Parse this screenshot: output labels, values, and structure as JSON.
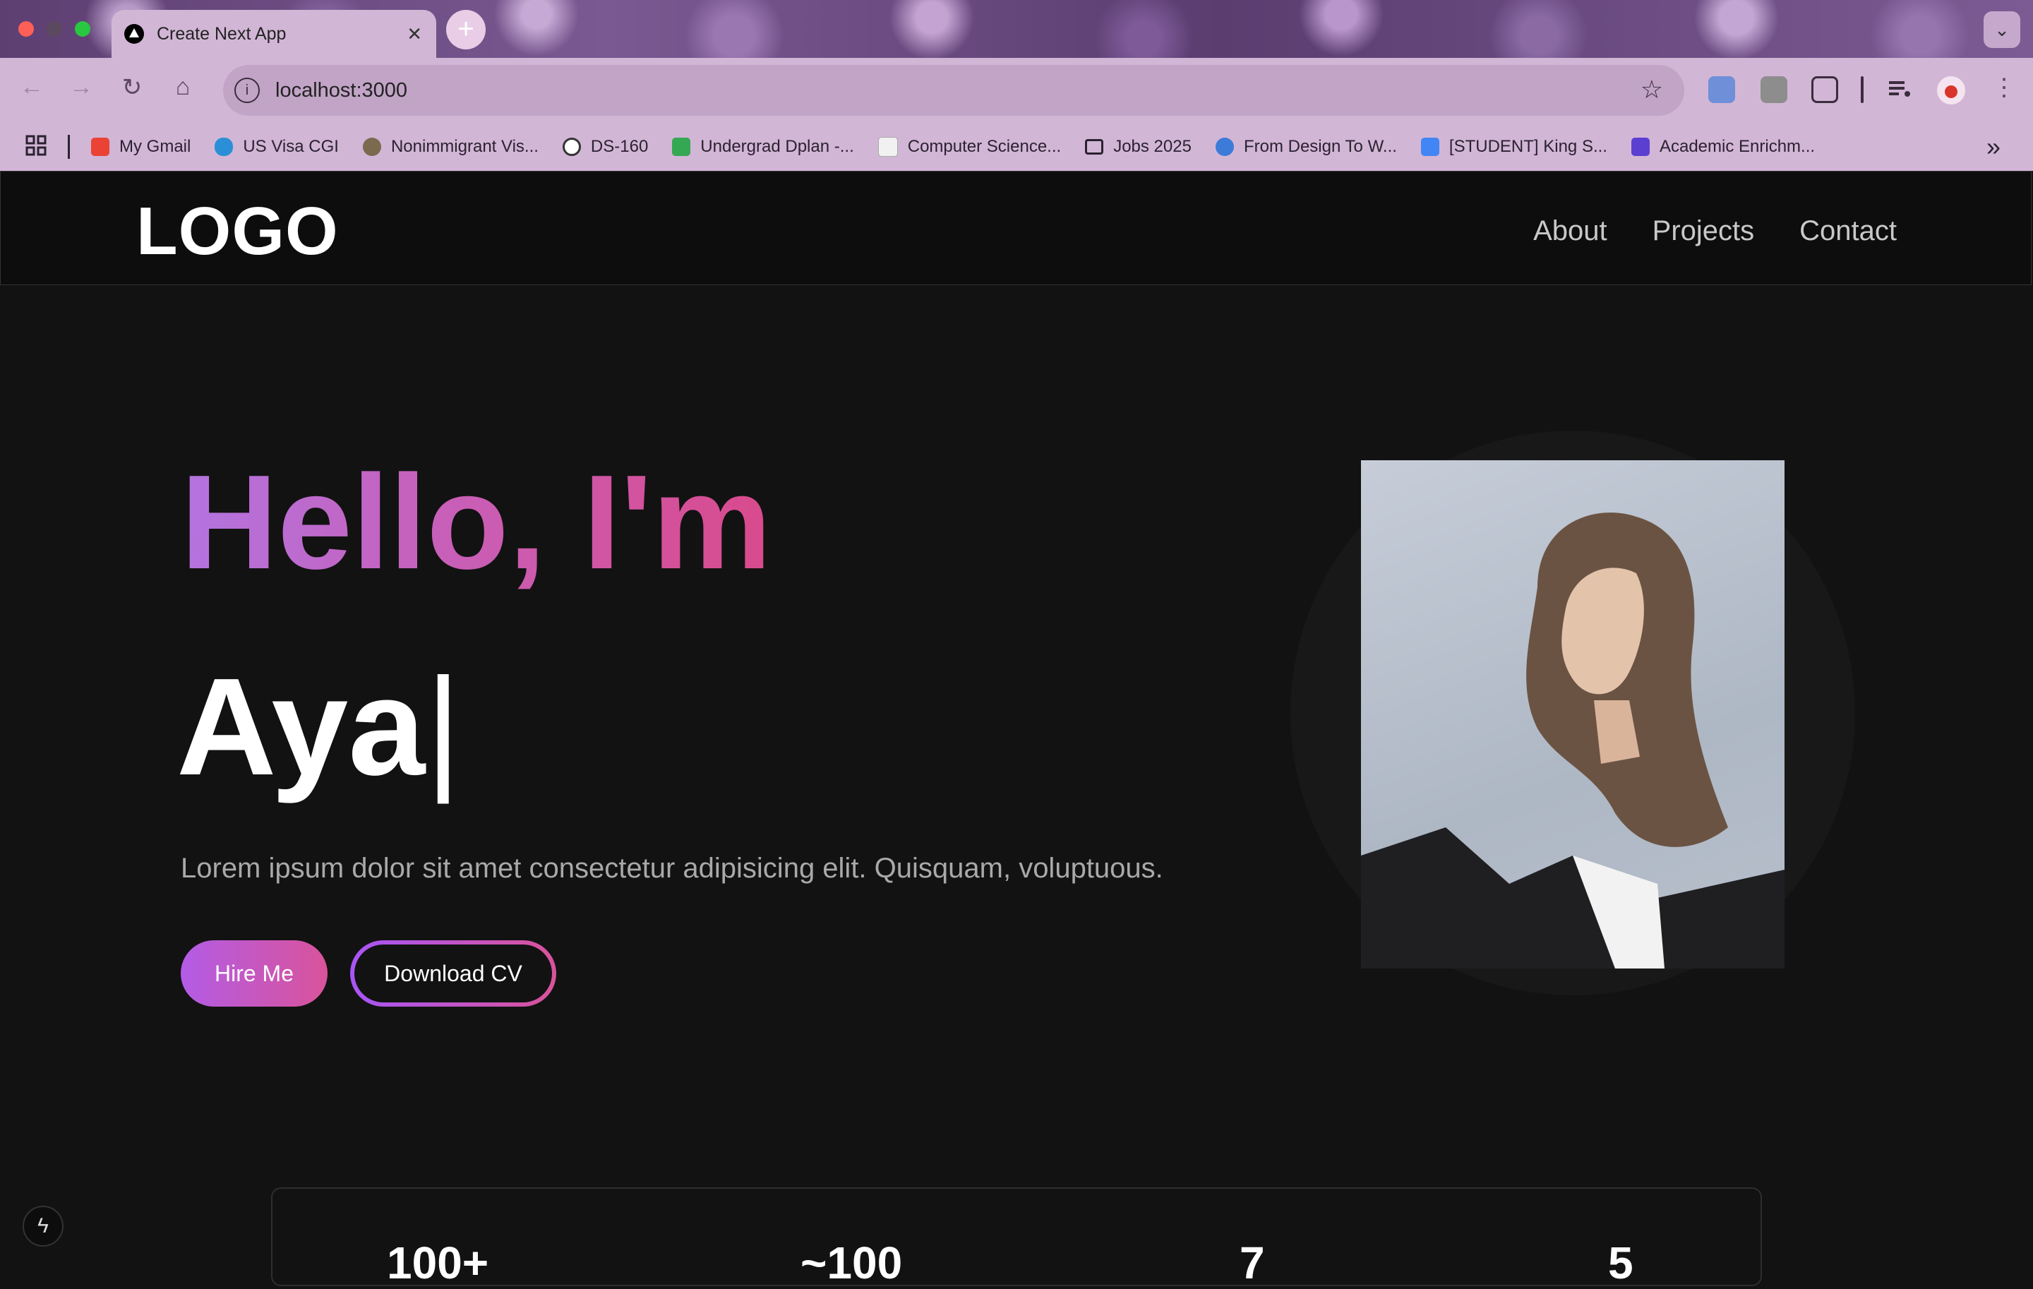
{
  "browser": {
    "tab_title": "Create Next App",
    "new_tab": "+",
    "close": "✕",
    "url": "localhost:3000",
    "bookmarks": [
      {
        "label": "My Gmail",
        "color": "#ea4335"
      },
      {
        "label": "US Visa CGI",
        "color": "#2a8fd6"
      },
      {
        "label": "Nonimmigrant Vis...",
        "color": "#7b6a4e"
      },
      {
        "label": "DS-160",
        "color": "#ffffff"
      },
      {
        "label": "Undergrad Dplan -...",
        "color": "#34a853"
      },
      {
        "label": "Computer Science...",
        "color": "#f1f1f1"
      },
      {
        "label": "Jobs 2025",
        "color": "#d2b6d6"
      },
      {
        "label": "From Design To W...",
        "color": "#3c7bd8"
      },
      {
        "label": "[STUDENT] King S...",
        "color": "#4285f4"
      },
      {
        "label": "Academic Enrichm...",
        "color": "#5b3fd1"
      }
    ],
    "more_bookmarks": "»"
  },
  "site": {
    "logo": "LOGO",
    "nav": [
      "About",
      "Projects",
      "Contact"
    ],
    "hero": {
      "greeting": "Hello, I'm",
      "name": "Aya",
      "cursor": "|",
      "description": "Lorem ipsum dolor sit amet consectetur adipisicing elit. Quisquam, voluptuous.",
      "hire_button": "Hire Me",
      "cv_button": "Download CV"
    },
    "stats": [
      "100+",
      "~100",
      "7",
      "5"
    ]
  },
  "colors": {
    "gradient_start": "#b374e0",
    "gradient_end": "#d94a8c",
    "background": "#121212"
  }
}
